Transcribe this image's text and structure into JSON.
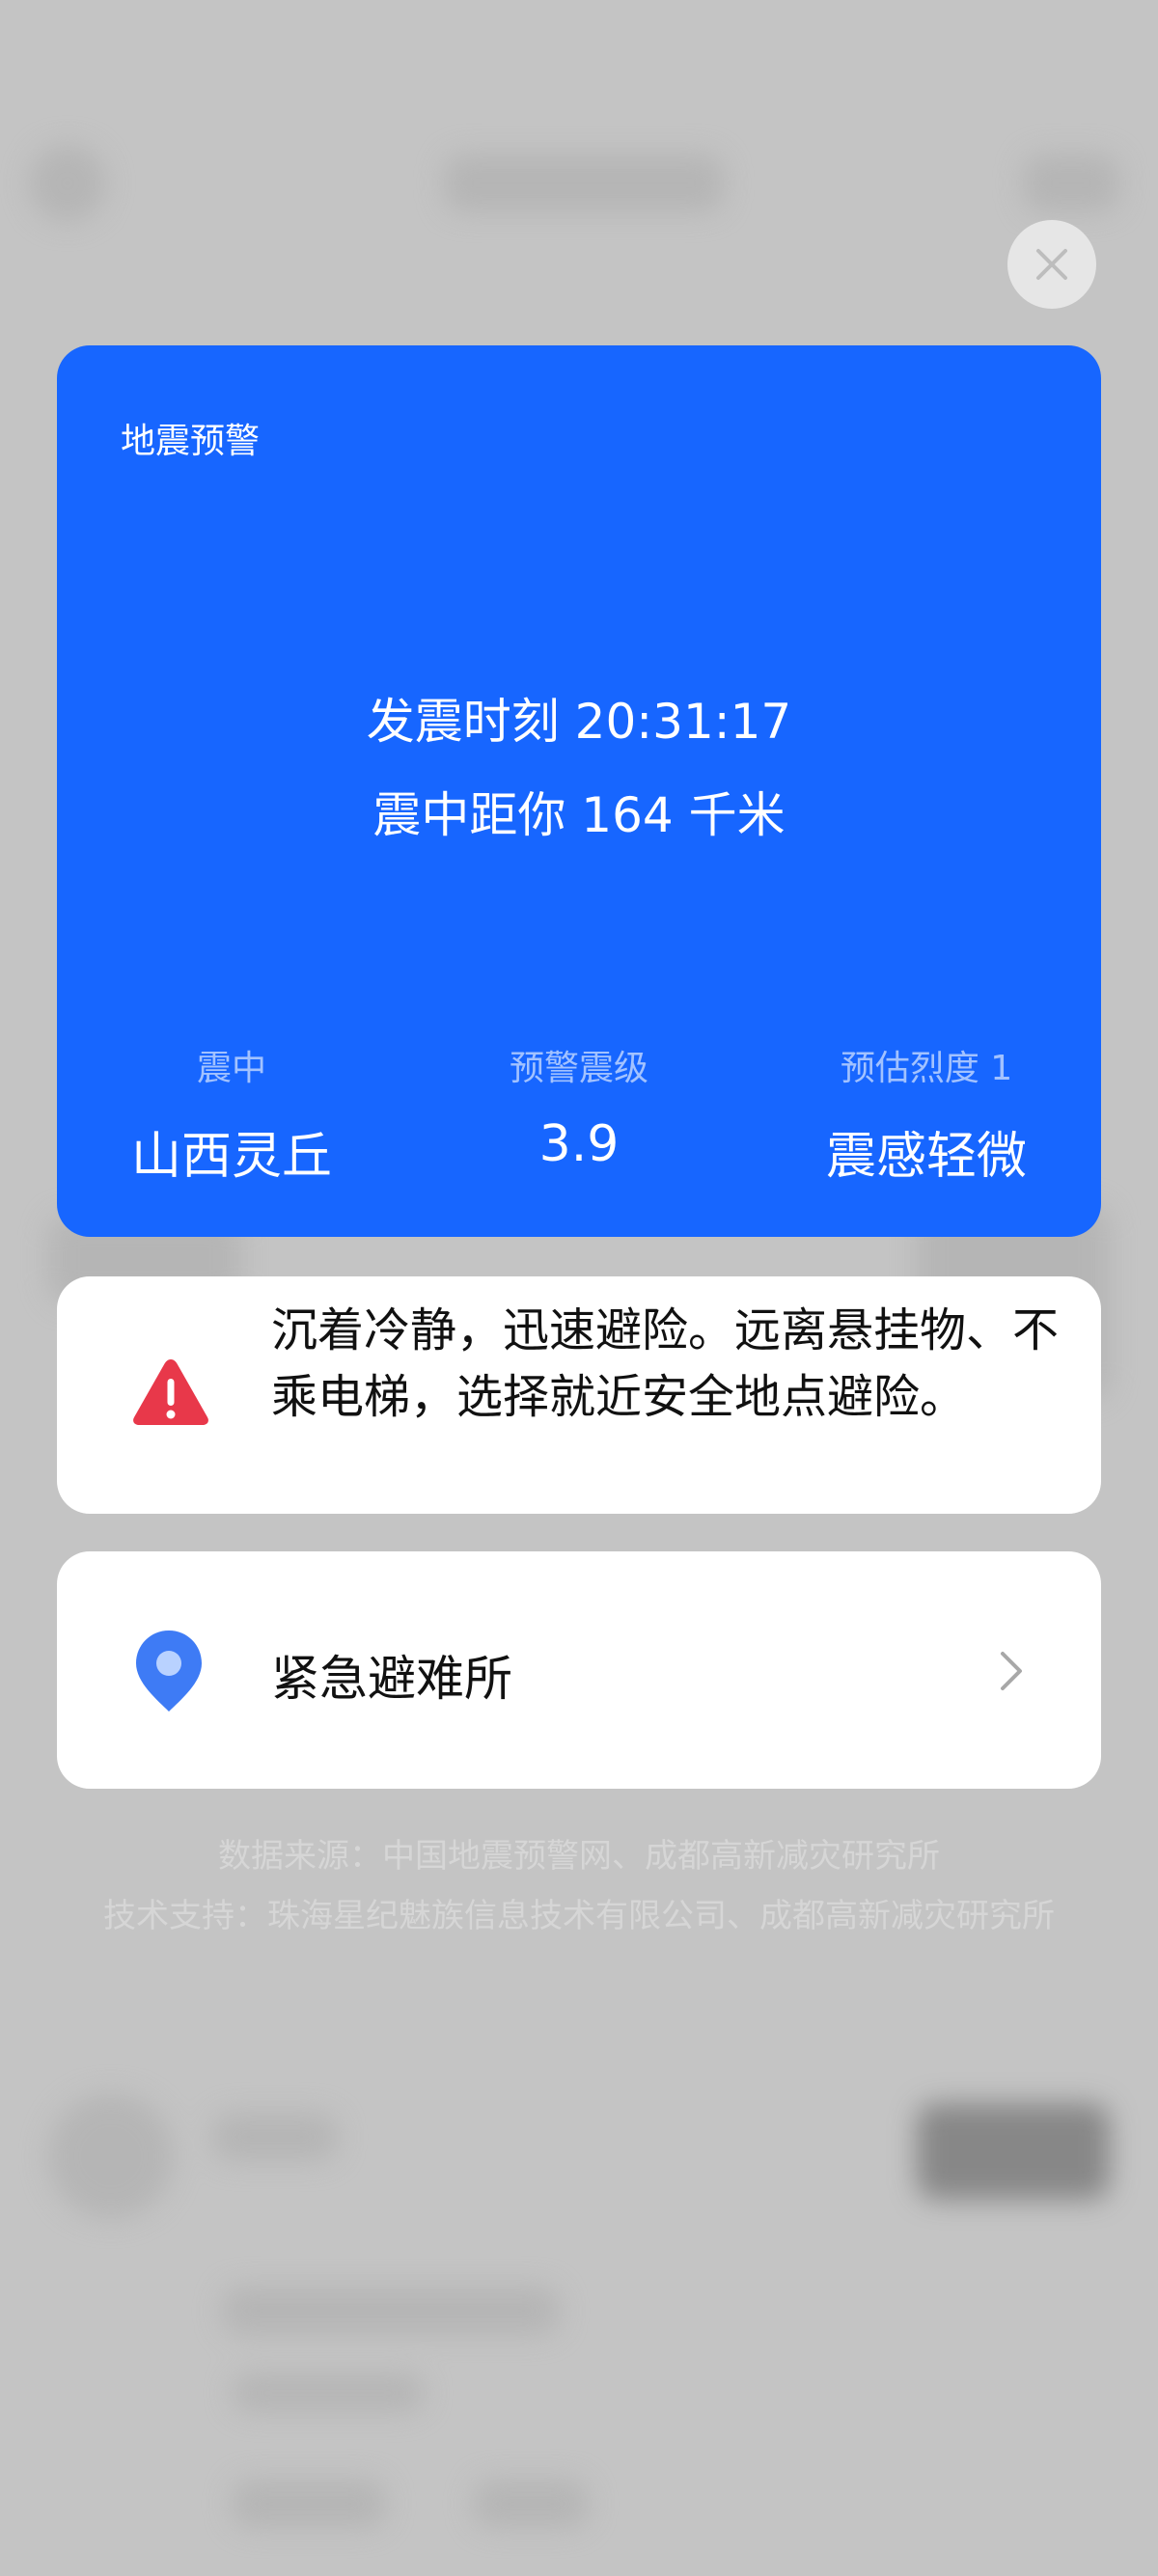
{
  "card": {
    "title": "地震预警",
    "time_line": "发震时刻 20:31:17",
    "distance_line": "震中距你 164 千米",
    "stats": [
      {
        "label": "震中",
        "value": "山西灵丘"
      },
      {
        "label": "预警震级",
        "value": "3.9"
      },
      {
        "label": "预估烈度 1",
        "value": "震感轻微"
      }
    ]
  },
  "tip": {
    "text": "沉着冷静，迅速避险。远离悬挂物、不乘电梯，选择就近安全地点避险。",
    "icon": "warning-triangle-icon"
  },
  "shelter": {
    "label": "紧急避难所",
    "icon": "location-pin-icon"
  },
  "footer": {
    "source": "数据来源：中国地震预警网、成都高新减灾研究所",
    "support": "技术支持：珠海星纪魅族信息技术有限公司、成都高新减灾研究所"
  },
  "colors": {
    "card_blue": "#1766ff",
    "warning_red": "#e8384a",
    "pin_blue": "#3e7bf5"
  }
}
